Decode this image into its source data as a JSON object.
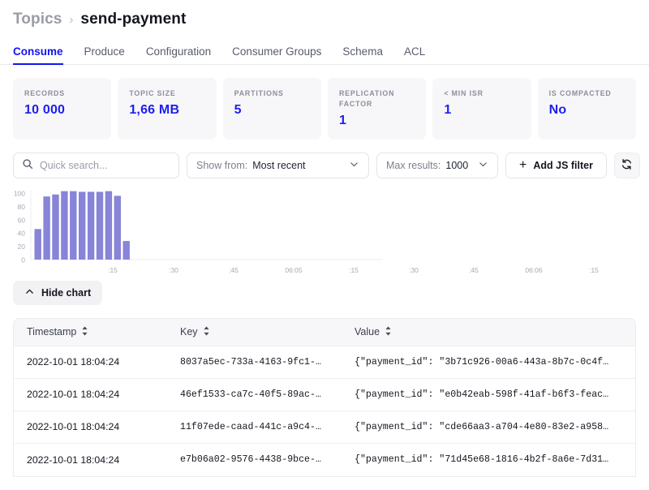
{
  "breadcrumb": {
    "root": "Topics",
    "separator": "›",
    "current": "send-payment"
  },
  "tabs": [
    {
      "label": "Consume",
      "active": true
    },
    {
      "label": "Produce",
      "active": false
    },
    {
      "label": "Configuration",
      "active": false
    },
    {
      "label": "Consumer Groups",
      "active": false
    },
    {
      "label": "Schema",
      "active": false
    },
    {
      "label": "ACL",
      "active": false
    }
  ],
  "stats": [
    {
      "label": "RECORDS",
      "value": "10 000"
    },
    {
      "label": "TOPIC SIZE",
      "value": "1,66 MB"
    },
    {
      "label": "PARTITIONS",
      "value": "5"
    },
    {
      "label": "REPLICATION FACTOR",
      "value": "1"
    },
    {
      "label": "< MIN ISR",
      "value": "1"
    },
    {
      "label": "IS COMPACTED",
      "value": "No"
    }
  ],
  "toolbar": {
    "search_placeholder": "Quick search...",
    "search_value": "",
    "show_from_label": "Show from:",
    "show_from_value": "Most recent",
    "max_results_label": "Max results:",
    "max_results_value": "1000",
    "add_filter_label": "Add JS filter",
    "add_filter_plus": "+",
    "refresh_title": "Refresh"
  },
  "chart_data": {
    "type": "bar",
    "title": "",
    "xlabel": "",
    "ylabel": "",
    "ylim": [
      0,
      100
    ],
    "yticks": [
      0,
      20,
      40,
      60,
      80,
      100
    ],
    "grid": false,
    "legend": false,
    "bar_color": "#8884d8",
    "categories": [
      "1",
      "2",
      "3",
      "4",
      "5",
      "6",
      "7",
      "8",
      "9",
      "10",
      "11"
    ],
    "values": [
      46,
      95,
      98,
      103,
      103,
      102,
      102,
      102,
      103,
      96,
      28
    ],
    "xtick_labels": [
      ":15",
      ":30",
      ":45",
      "06:05",
      ":15",
      ":30",
      ":45",
      "06:06",
      ":15"
    ]
  },
  "hide_chart": {
    "label": "Hide chart"
  },
  "table": {
    "columns": [
      {
        "label": "Timestamp"
      },
      {
        "label": "Key"
      },
      {
        "label": "Value"
      }
    ],
    "rows": [
      {
        "timestamp": "2022-10-01 18:04:24",
        "key": "8037a5ec-733a-4163-9fc1-…",
        "value": "{\"payment_id\": \"3b71c926-00a6-443a-8b7c-0c4f…"
      },
      {
        "timestamp": "2022-10-01 18:04:24",
        "key": "46ef1533-ca7c-40f5-89ac-…",
        "value": "{\"payment_id\": \"e0b42eab-598f-41af-b6f3-feac…"
      },
      {
        "timestamp": "2022-10-01 18:04:24",
        "key": "11f07ede-caad-441c-a9c4-…",
        "value": "{\"payment_id\": \"cde66aa3-a704-4e80-83e2-a958…"
      },
      {
        "timestamp": "2022-10-01 18:04:24",
        "key": "e7b06a02-9576-4438-9bce-…",
        "value": "{\"payment_id\": \"71d45e68-1816-4b2f-8a6e-7d31…"
      }
    ]
  },
  "colors": {
    "accent": "#1414f0",
    "bar": "#8884d8",
    "card_bg": "#f7f7f9"
  }
}
